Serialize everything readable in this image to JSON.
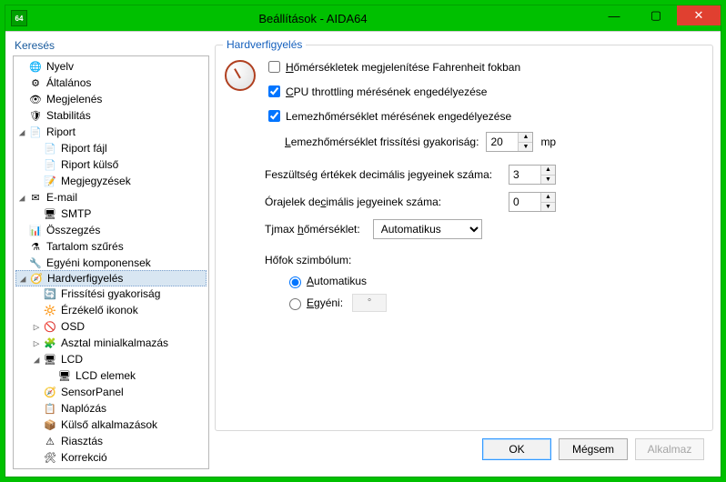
{
  "window": {
    "title": "Beállítások - AIDA64",
    "app_icon_text": "64"
  },
  "left_panel": {
    "title": "Keresés"
  },
  "tree": [
    {
      "depth": 0,
      "tw": "",
      "icon": "globe",
      "label": "Nyelv",
      "sel": false
    },
    {
      "depth": 0,
      "tw": "",
      "icon": "gear",
      "label": "Általános",
      "sel": false
    },
    {
      "depth": 0,
      "tw": "",
      "icon": "eye",
      "label": "Megjelenés",
      "sel": false
    },
    {
      "depth": 0,
      "tw": "",
      "icon": "shield",
      "label": "Stabilitás",
      "sel": false
    },
    {
      "depth": 0,
      "tw": "▾",
      "icon": "doc",
      "label": "Riport",
      "sel": false
    },
    {
      "depth": 1,
      "tw": "",
      "icon": "file",
      "label": "Riport fájl",
      "sel": false
    },
    {
      "depth": 1,
      "tw": "",
      "icon": "globe-doc",
      "label": "Riport külső",
      "sel": false
    },
    {
      "depth": 1,
      "tw": "",
      "icon": "note",
      "label": "Megjegyzések",
      "sel": false
    },
    {
      "depth": 0,
      "tw": "▾",
      "icon": "mail",
      "label": "E-mail",
      "sel": false
    },
    {
      "depth": 1,
      "tw": "",
      "icon": "server",
      "label": "SMTP",
      "sel": false
    },
    {
      "depth": 0,
      "tw": "",
      "icon": "list",
      "label": "Összegzés",
      "sel": false
    },
    {
      "depth": 0,
      "tw": "",
      "icon": "funnel",
      "label": "Tartalom szűrés",
      "sel": false
    },
    {
      "depth": 0,
      "tw": "",
      "icon": "comp",
      "label": "Egyéni komponensek",
      "sel": false
    },
    {
      "depth": 0,
      "tw": "▾",
      "icon": "gauge",
      "label": "Hardverfigyelés",
      "sel": true
    },
    {
      "depth": 1,
      "tw": "",
      "icon": "refresh",
      "label": "Frissítési gyakoriság",
      "sel": false
    },
    {
      "depth": 1,
      "tw": "",
      "icon": "sensor",
      "label": "Érzékelő ikonok",
      "sel": false
    },
    {
      "depth": 1,
      "tw": "▸",
      "icon": "osd",
      "label": "OSD",
      "sel": false
    },
    {
      "depth": 1,
      "tw": "▸",
      "icon": "gadget",
      "label": "Asztal minialkalmazás",
      "sel": false
    },
    {
      "depth": 1,
      "tw": "▾",
      "icon": "lcd",
      "label": "LCD",
      "sel": false
    },
    {
      "depth": 2,
      "tw": "",
      "icon": "lcd",
      "label": "LCD elemek",
      "sel": false
    },
    {
      "depth": 1,
      "tw": "",
      "icon": "gauge",
      "label": "SensorPanel",
      "sel": false
    },
    {
      "depth": 1,
      "tw": "",
      "icon": "log",
      "label": "Naplózás",
      "sel": false
    },
    {
      "depth": 1,
      "tw": "",
      "icon": "ext",
      "label": "Külső alkalmazások",
      "sel": false
    },
    {
      "depth": 1,
      "tw": "",
      "icon": "warn",
      "label": "Riasztás",
      "sel": false
    },
    {
      "depth": 1,
      "tw": "",
      "icon": "tools",
      "label": "Korrekció",
      "sel": false
    }
  ],
  "group": {
    "title": "Hardverfigyelés",
    "fahrenheit_label": "Hőmérsékletek megjelenítése Fahrenheit fokban",
    "fahrenheit_checked": false,
    "cpu_throttle_label_pre": "C",
    "cpu_throttle_label": "PU throttling mérésének engedélyezése",
    "cpu_throttle_checked": true,
    "disk_temp_label": "Lemezhőmérséklet mérésének engedélyezése",
    "disk_temp_checked": true,
    "disk_refresh_label_pre": "L",
    "disk_refresh_label": "emezhőmérséklet frissítési gyakoriság:",
    "disk_refresh_value": "20",
    "disk_refresh_unit": "mp",
    "volt_digits_label": "Feszültség értékek decimális jegyeinek száma:",
    "volt_digits_value": "3",
    "clock_digits_label_pre": "Órajelek de",
    "clock_digits_label_u": "c",
    "clock_digits_label_post": "imális jegyeinek száma:",
    "clock_digits_value": "0",
    "tjmax_label_pre": "Tjmax ",
    "tjmax_label_u": "h",
    "tjmax_label_post": "őmérséklet:",
    "tjmax_value": "Automatikus",
    "degree_group_title": "Hőfok szimbólum:",
    "radio_auto_u": "A",
    "radio_auto": "utomatikus",
    "radio_custom_u": "E",
    "radio_custom": "gyéni:",
    "degree_placeholder": "°"
  },
  "footer": {
    "ok": "OK",
    "cancel": "Mégsem",
    "apply": "Alkalmaz"
  }
}
